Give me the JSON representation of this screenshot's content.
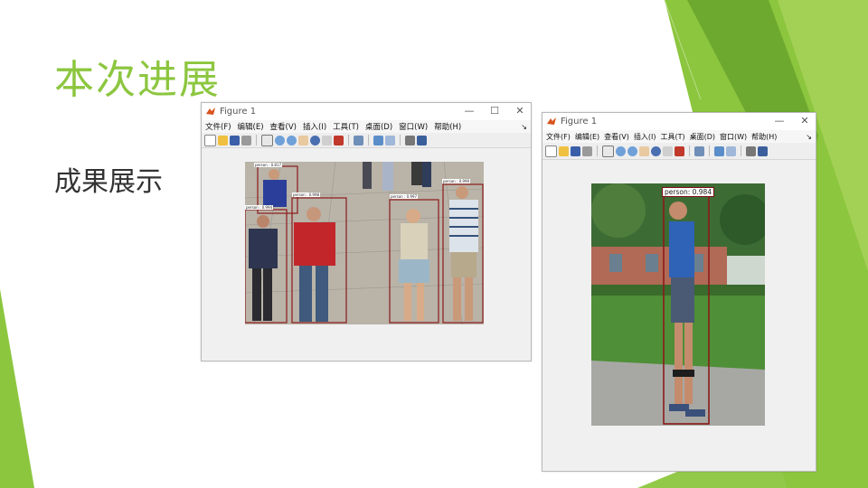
{
  "slide": {
    "title": "本次进展",
    "subtitle": "成果展示",
    "accent_color": "#8cc63f"
  },
  "windows": [
    {
      "title": "Figure 1",
      "menus": [
        "文件(F)",
        "编辑(E)",
        "查看(V)",
        "插入(I)",
        "工具(T)",
        "桌面(D)",
        "窗口(W)",
        "帮助(H)"
      ],
      "menu_overflow": "↘",
      "controls": [
        "—",
        "☐",
        "✕"
      ],
      "toolbar_icons": [
        "new-file-icon",
        "open-folder-icon",
        "save-icon",
        "print-icon",
        "pointer-icon",
        "zoom-in-icon",
        "zoom-out-icon",
        "pan-hand-icon",
        "rotate-3d-icon",
        "data-cursor-icon",
        "brush-icon",
        "link-icon",
        "colorbar-icon",
        "legend-icon",
        "hide-plot-tools-icon",
        "show-plot-tools-icon"
      ],
      "detections": [
        {
          "label": "person : 0.817"
        },
        {
          "label": "person : 0.998"
        },
        {
          "label": "person : 0.997"
        },
        {
          "label": "person : 0.999"
        },
        {
          "label": "person : 0.994"
        },
        {
          "label": "person : 0.952"
        }
      ]
    },
    {
      "title": "Figure 1",
      "menus": [
        "文件(F)",
        "编辑(E)",
        "查看(V)",
        "插入(I)",
        "工具(T)",
        "桌面(D)",
        "窗口(W)",
        "帮助(H)"
      ],
      "menu_overflow": "↘",
      "controls": [
        "—",
        "✕"
      ],
      "toolbar_icons": [
        "new-file-icon",
        "open-folder-icon",
        "save-icon",
        "print-icon",
        "pointer-icon",
        "zoom-in-icon",
        "zoom-out-icon",
        "pan-hand-icon",
        "rotate-3d-icon",
        "data-cursor-icon",
        "brush-icon",
        "link-icon",
        "colorbar-icon",
        "legend-icon",
        "hide-plot-tools-icon",
        "show-plot-tools-icon"
      ],
      "detections": [
        {
          "label": "person: 0.984"
        }
      ]
    }
  ]
}
